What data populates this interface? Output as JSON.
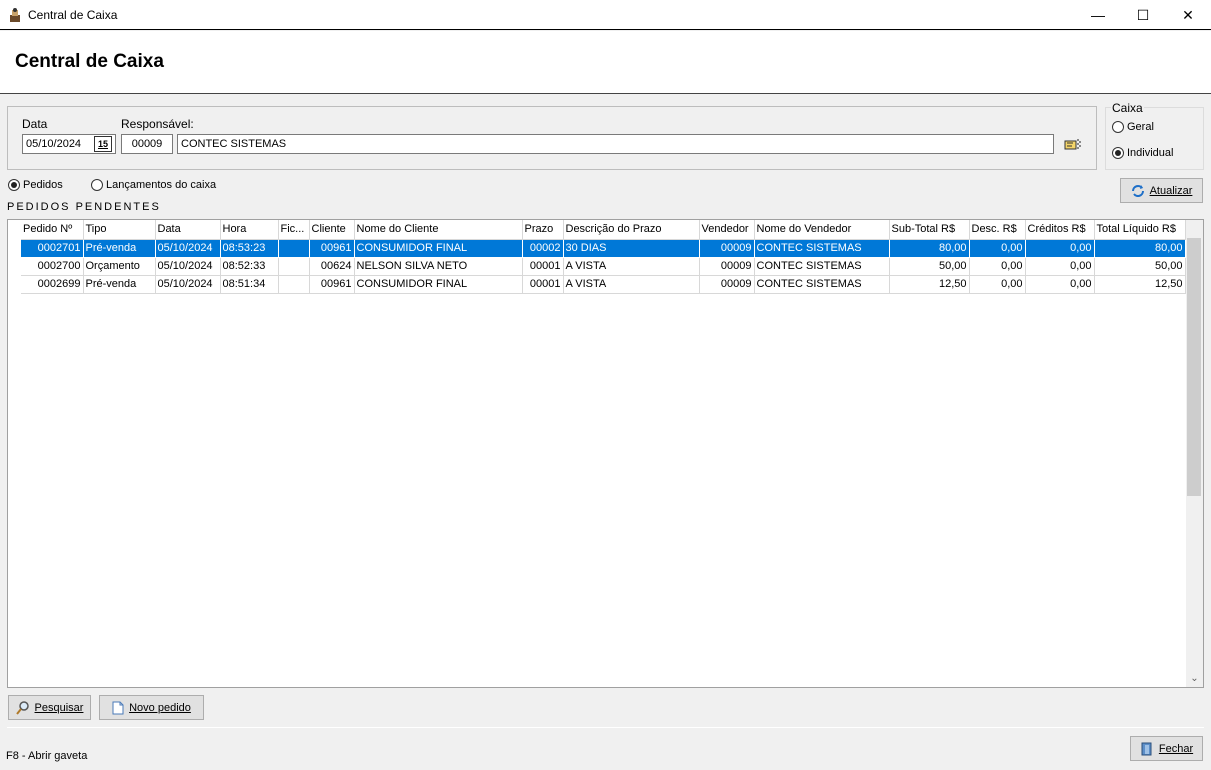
{
  "window": {
    "title": "Central de Caixa",
    "minimize": "—",
    "maximize": "☐",
    "close": "✕"
  },
  "header": {
    "title": "Central de Caixa"
  },
  "filters": {
    "data_label": "Data",
    "data_value": "05/10/2024",
    "cal_glyph": "15",
    "responsavel_label": "Responsável:",
    "responsavel_code": "00009",
    "responsavel_name": "CONTEC SISTEMAS"
  },
  "caixa": {
    "label": "Caixa",
    "options": [
      "Geral",
      "Individual"
    ],
    "selected": "Individual"
  },
  "view": {
    "options": [
      "Pedidos",
      "Lançamentos do caixa"
    ],
    "selected": "Pedidos"
  },
  "buttons": {
    "atualizar": "Atualizar",
    "pesquisar": "Pesquisar",
    "novo_pedido": "Novo pedido",
    "fechar": "Fechar"
  },
  "section_title": "PEDIDOS PENDENTES",
  "table": {
    "columns": [
      "Pedido Nº",
      "Tipo",
      "Data",
      "Hora",
      "Fic...",
      "Cliente",
      "Nome do Cliente",
      "Prazo",
      "Descrição do Prazo",
      "Vendedor",
      "Nome do Vendedor",
      "Sub-Total R$",
      "Desc. R$",
      "Créditos R$",
      "Total Líquido R$"
    ],
    "rows": [
      [
        "0002701",
        "Pré-venda",
        "05/10/2024",
        "08:53:23",
        "",
        "00961",
        "CONSUMIDOR FINAL",
        "00002",
        "30 DIAS",
        "00009",
        "CONTEC SISTEMAS",
        "80,00",
        "0,00",
        "0,00",
        "80,00"
      ],
      [
        "0002700",
        "Orçamento",
        "05/10/2024",
        "08:52:33",
        "",
        "00624",
        "NELSON SILVA NETO",
        "00001",
        "A VISTA",
        "00009",
        "CONTEC SISTEMAS",
        "50,00",
        "0,00",
        "0,00",
        "50,00"
      ],
      [
        "0002699",
        "Pré-venda",
        "05/10/2024",
        "08:51:34",
        "",
        "00961",
        "CONSUMIDOR FINAL",
        "00001",
        "A VISTA",
        "00009",
        "CONTEC SISTEMAS",
        "12,50",
        "0,00",
        "0,00",
        "12,50"
      ]
    ],
    "selected_row": 0
  },
  "status": {
    "hint": "F8 - Abrir gaveta"
  },
  "colors": {
    "selection": "#0078d7",
    "window_bg": "#f0f0f0"
  }
}
